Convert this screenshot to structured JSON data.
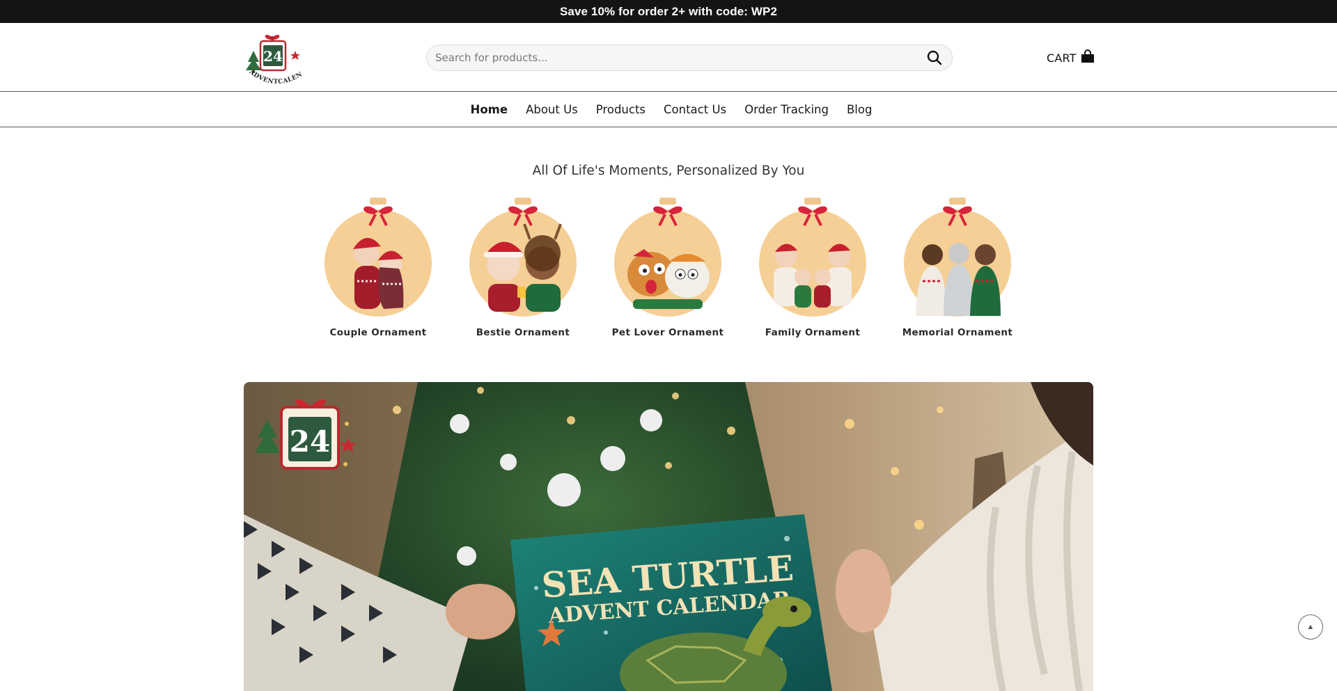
{
  "promo": {
    "text": "Save 10% for order 2+ with code: WP2"
  },
  "header": {
    "logo": {
      "number": "24",
      "wordmark": "ADVENTCALENDAFUN"
    },
    "search": {
      "placeholder": "Search for products...",
      "value": ""
    },
    "cart": {
      "label": "CART"
    }
  },
  "nav": {
    "items": [
      {
        "label": "Home",
        "active": true
      },
      {
        "label": "About Us"
      },
      {
        "label": "Products"
      },
      {
        "label": "Contact Us"
      },
      {
        "label": "Order Tracking"
      },
      {
        "label": "Blog"
      }
    ]
  },
  "section": {
    "title": "All Of Life's Moments, Personalized By You"
  },
  "ornaments": [
    {
      "label": "Couple Ornament"
    },
    {
      "label": "Bestie Ornament"
    },
    {
      "label": "Pet Lover Ornament"
    },
    {
      "label": "Family Ornament"
    },
    {
      "label": "Memorial Ornament"
    }
  ],
  "hero": {
    "logo_number": "24",
    "product_title_line1": "SEA TURTLE",
    "product_title_line2": "ADVENT CALENDAR"
  },
  "colors": {
    "promo_bg": "#141414",
    "ornament_gold": "#f4cf92",
    "ribbon_red": "#d6243a",
    "box_teal": "#17706a"
  }
}
